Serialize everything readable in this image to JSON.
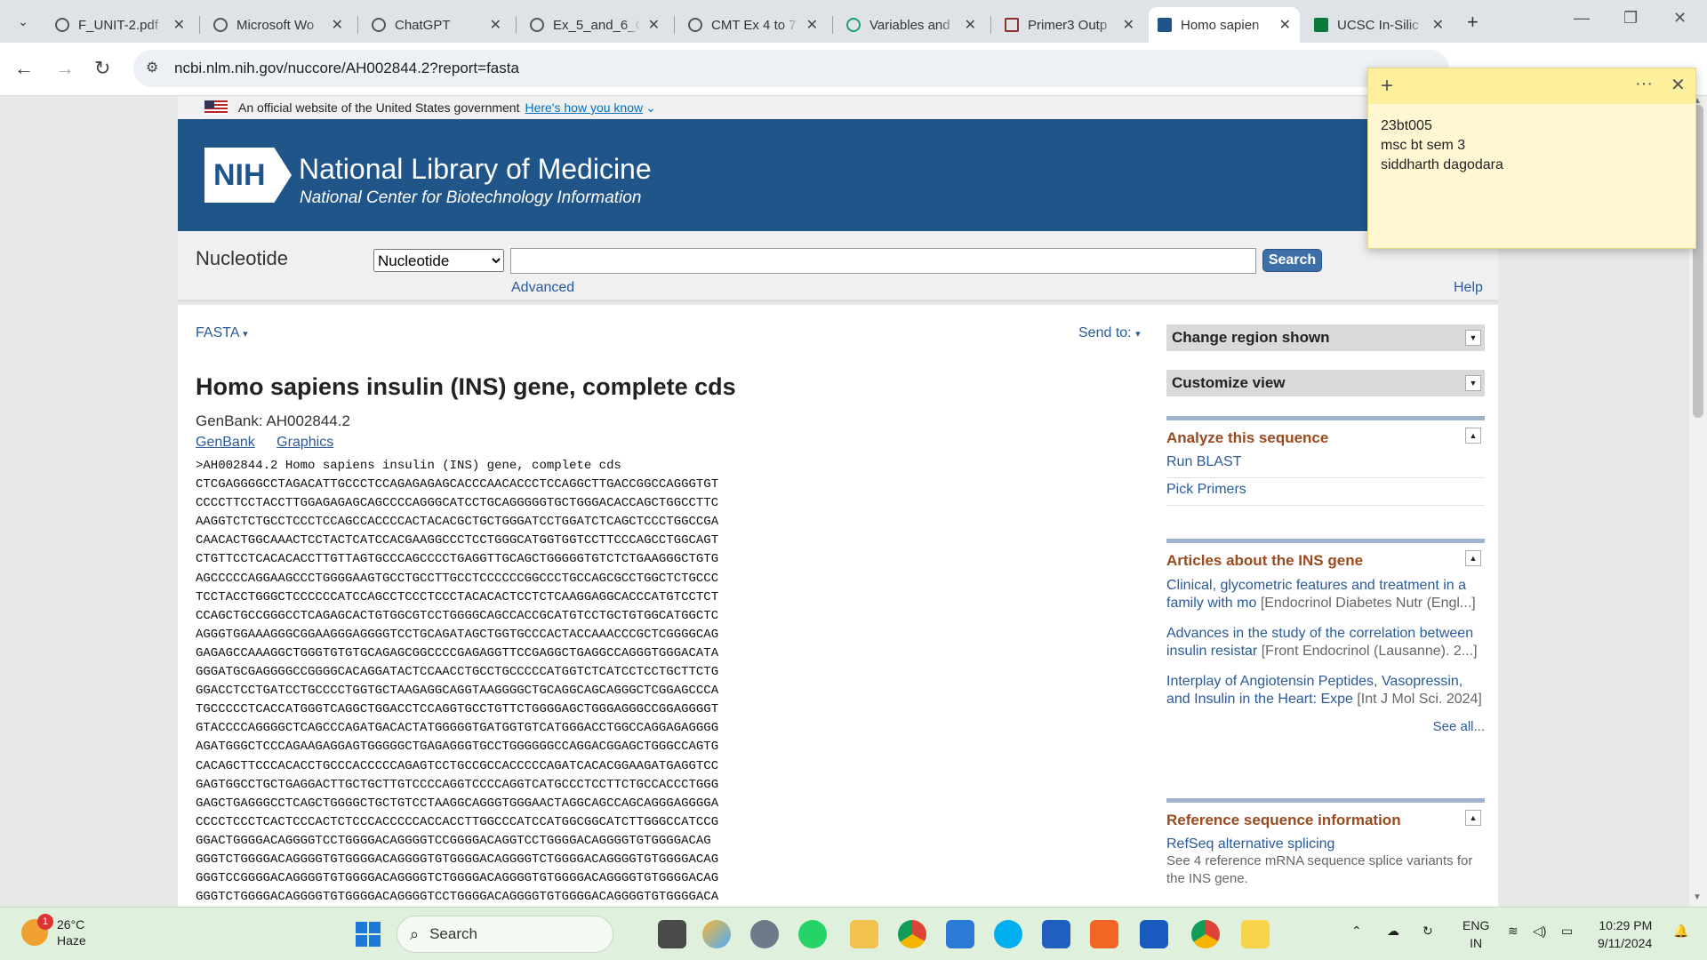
{
  "tabs": [
    {
      "title": "F_UNIT-2.pdf",
      "active": false
    },
    {
      "title": "Microsoft Wo",
      "active": false
    },
    {
      "title": "ChatGPT",
      "active": false
    },
    {
      "title": "Ex_5_and_6_C",
      "active": false
    },
    {
      "title": "CMT Ex 4 to 7",
      "active": false
    },
    {
      "title": "Variables and",
      "active": false
    },
    {
      "title": "Primer3 Outp",
      "active": false
    },
    {
      "title": "Homo sapien",
      "active": true
    },
    {
      "title": "UCSC In-Silic",
      "active": false
    }
  ],
  "address": {
    "url": "ncbi.nlm.nih.gov/nuccore/AH002844.2?report=fasta"
  },
  "gov_banner": {
    "text": "An official website of the United States government",
    "link": "Here's how you know"
  },
  "nlm": {
    "logo": "NIH",
    "title": "National Library of Medicine",
    "subtitle": "National Center for Biotechnology Information"
  },
  "search": {
    "db_label": "Nucleotide",
    "db_selected": "Nucleotide",
    "query": "",
    "button": "Search",
    "advanced": "Advanced",
    "help": "Help"
  },
  "record": {
    "format": "FASTA",
    "send_to": "Send to:",
    "title": "Homo sapiens insulin (INS) gene, complete cds",
    "genbank": "GenBank: AH002844.2",
    "links": [
      "GenBank",
      "Graphics"
    ],
    "fasta_header": ">AH002844.2 Homo sapiens insulin (INS) gene, complete cds",
    "sequence_lines": [
      "CTCGAGGGGCCTAGACATTGCCCTCCAGAGAGAGCACCCAACACCCTCCAGGCTTGACCGGCCAGGGTGT",
      "CCCCTTCCTACCTTGGAGAGAGCAGCCCCAGGGCATCCTGCAGGGGGTGCTGGGACACCAGCTGGCCTTC",
      "AAGGTCTCTGCCTCCCTCCAGCCACCCCACTACACGCTGCTGGGATCCTGGATCTCAGCTCCCTGGCCGA",
      "CAACACTGGCAAACTCCTACTCATCCACGAAGGCCCTCCTGGGCATGGTGGTCCTTCCCAGCCTGGCAGT",
      "CTGTTCCTCACACACCTTGTTAGTGCCCAGCCCCTGAGGTTGCAGCTGGGGGTGTCTCTGAAGGGCTGTG",
      "AGCCCCCAGGAAGCCCTGGGGAAGTGCCTGCCTTGCCTCCCCCCGGCCCTGCCAGCGCCTGGCTCTGCCC",
      "TCCTACCTGGGCTCCCCCCATCCAGCCTCCCTCCCTACACACTCCTCTCAAGGAGGCACCCATGTCCTCT",
      "CCAGCTGCCGGGCCTCAGAGCACTGTGGCGTCCTGGGGCAGCCACCGCATGTCCTGCTGTGGCATGGCTC",
      "AGGGTGGAAAGGGCGGAAGGGAGGGGTCCTGCAGATAGCTGGTGCCCACTACCAAACCCGCTCGGGGCAG",
      "GAGAGCCAAAGGCTGGGTGTGTGCAGAGCGGCCCCGAGAGGTTCCGAGGCTGAGGCCAGGGTGGGACATA",
      "GGGATGCGAGGGGCCGGGGCACAGGATACTCCAACCTGCCTGCCCCCATGGTCTCATCCTCCTGCTTCTG",
      "GGACCTCCTGATCCTGCCCCTGGTGCTAAGAGGCAGGTAAGGGGCTGCAGGCAGCAGGGCTCGGAGCCCA",
      "TGCCCCCTCACCATGGGTCAGGCTGGACCTCCAGGTGCCTGTTCTGGGGAGCTGGGAGGGCCGGAGGGGT",
      "GTACCCCAGGGGCTCAGCCCAGATGACACTATGGGGGTGATGGTGTCATGGGACCTGGCCAGGAGAGGGG",
      "AGATGGGCTCCCAGAAGAGGAGTGGGGGCTGAGAGGGTGCCTGGGGGGCCAGGACGGAGCTGGGCCAGTG",
      "CACAGCTTCCCACACCTGCCCACCCCCAGAGTCCTGCCGCCACCCCCAGATCACACGGAAGATGAGGTCC",
      "GAGTGGCCTGCTGAGGACTTGCTGCTTGTCCCCAGGTCCCCAGGTCATGCCCTCCTTCTGCCACCCTGGG",
      "GAGCTGAGGGCCTCAGCTGGGGCTGCTGTCCTAAGGCAGGGTGGGAACTAGGCAGCCAGCAGGGAGGGGA",
      "CCCCTCCCTCACTCCCACTCTCCCACCCCCACCACCTTGGCCCATCCATGGCGGCATCTTGGGCCATCCG",
      "GGACTGGGGACAGGGGTCCTGGGGACAGGGGTCCGGGGACAGGTCCTGGGGACAGGGGTGTGGGGACAG",
      "GGGTCTGGGGACAGGGGTGTGGGGACAGGGGTGTGGGGACAGGGGTCTGGGGACAGGGGTGTGGGGACAG",
      "GGGTCCGGGGACAGGGGTGTGGGGACAGGGGTCTGGGGACAGGGGTGTGGGGACAGGGGTGTGGGGACAG",
      "GGGTCTGGGGACAGGGGTGTGGGGACAGGGGTCCTGGGGACAGGGGTGTGGGGACAGGGGTGTGGGGACA"
    ]
  },
  "sidebar": {
    "change_region": "Change region shown",
    "customize_view": "Customize view",
    "analyze": {
      "heading": "Analyze this sequence",
      "items": [
        "Run BLAST",
        "Pick Primers"
      ]
    },
    "articles": {
      "heading": "Articles about the INS gene",
      "items": [
        {
          "title": "Clinical, glycometric features and treatment in a family with mo",
          "source": "[Endocrinol Diabetes Nutr (Engl...]"
        },
        {
          "title": "Advances in the study of the correlation between insulin resistar",
          "source": "[Front Endocrinol (Lausanne). 2...]"
        },
        {
          "title": "Interplay of Angiotensin Peptides, Vasopressin, and Insulin in the Heart: Expe",
          "source": "[Int J Mol Sci. 2024]"
        }
      ],
      "see_all": "See all..."
    },
    "refseq": {
      "heading": "Reference sequence information",
      "link": "RefSeq alternative splicing",
      "desc": "See 4 reference mRNA sequence splice variants for the INS gene."
    }
  },
  "sticky_note": {
    "lines": [
      "23bt005",
      "msc bt sem 3",
      "siddharth dagodara"
    ]
  },
  "taskbar": {
    "weather_temp": "26°C",
    "weather_desc": "Haze",
    "weather_badge": "1",
    "search_placeholder": "Search",
    "lang_1": "ENG",
    "lang_2": "IN",
    "time": "10:29 PM",
    "date": "9/11/2024"
  }
}
